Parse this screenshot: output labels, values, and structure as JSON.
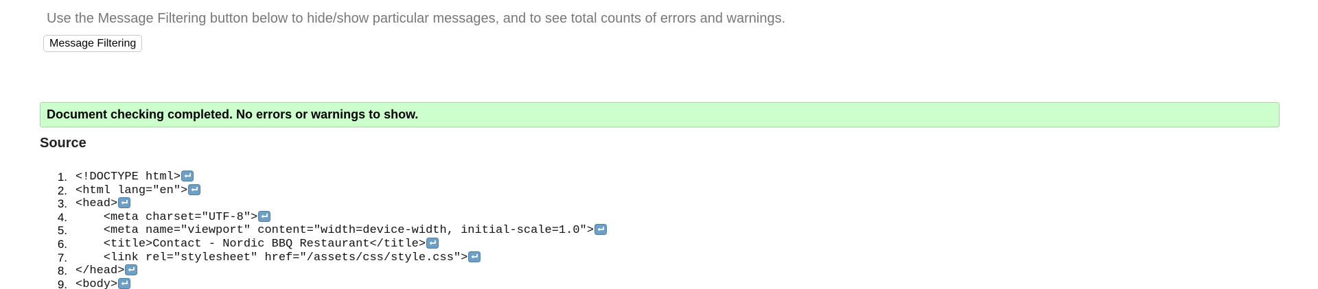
{
  "intro": {
    "text": "Use the Message Filtering button below to hide/show particular messages, and to see total counts of errors and warnings."
  },
  "filter_button": {
    "label": "Message Filtering"
  },
  "status": {
    "message": "Document checking completed. No errors or warnings to show.",
    "background_color": "#ccffcc"
  },
  "source": {
    "heading": "Source",
    "line_end_icon": "return-icon",
    "lines": [
      {
        "number": "1.",
        "code": "<!DOCTYPE html>"
      },
      {
        "number": "2.",
        "code": "<html lang=\"en\">"
      },
      {
        "number": "3.",
        "code": "<head>"
      },
      {
        "number": "4.",
        "code": "    <meta charset=\"UTF-8\">"
      },
      {
        "number": "5.",
        "code": "    <meta name=\"viewport\" content=\"width=device-width, initial-scale=1.0\">"
      },
      {
        "number": "6.",
        "code": "    <title>Contact - Nordic BBQ Restaurant</title>"
      },
      {
        "number": "7.",
        "code": "    <link rel=\"stylesheet\" href=\"/assets/css/style.css\">"
      },
      {
        "number": "8.",
        "code": "</head>"
      },
      {
        "number": "9.",
        "code": "<body>"
      }
    ]
  }
}
